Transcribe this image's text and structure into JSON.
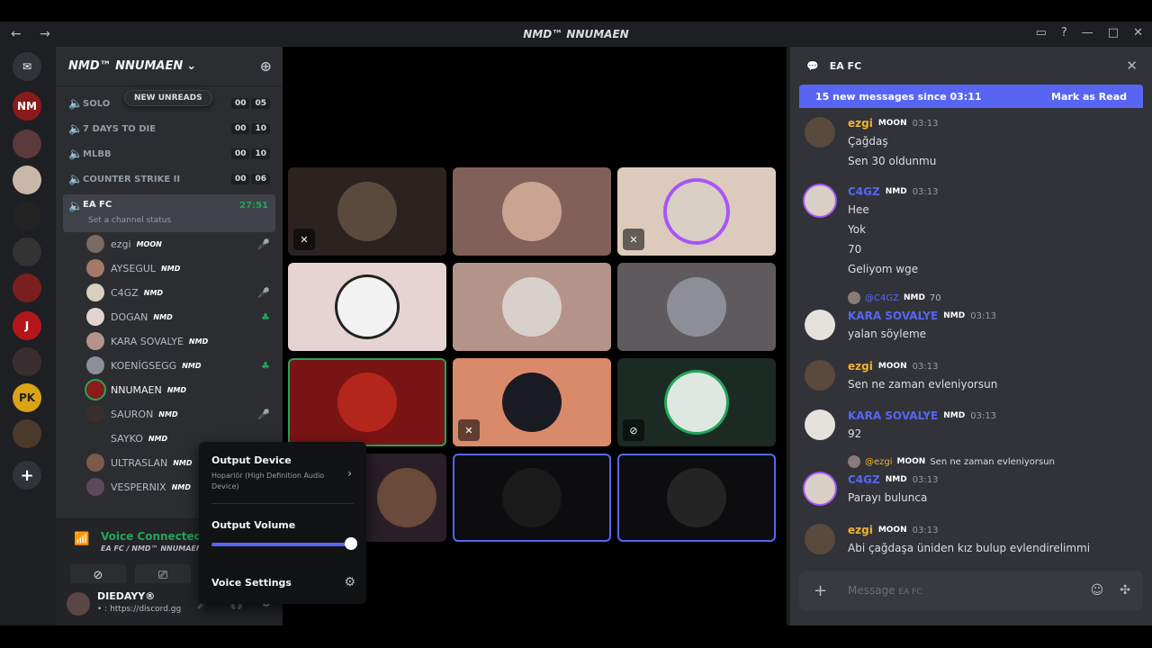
{
  "window": {
    "title": "NMD™ NNUMAEN",
    "nav": "← →",
    "controls": [
      "▭",
      "?",
      "—",
      "□",
      "✕"
    ]
  },
  "guilds": [
    "NM",
    "",
    "",
    "",
    "",
    "",
    "J",
    "",
    "PK",
    ""
  ],
  "server": {
    "name": "NMD™ NNUMAEN"
  },
  "new_unreads": "NEW UNREADS",
  "channels": [
    {
      "name": "SOLO",
      "badges": [
        "00",
        "05"
      ]
    },
    {
      "name": "7 DAYS TO DIE",
      "badges": [
        "00",
        "10"
      ]
    },
    {
      "name": "MLBB",
      "badges": [
        "00",
        "10"
      ]
    },
    {
      "name": "COUNTER STRIKE II",
      "badges": [
        "00",
        "06"
      ]
    }
  ],
  "active_channel": {
    "name": "EA FC",
    "time": "27:51",
    "status": "Set a channel status"
  },
  "members": [
    {
      "name": "ezgi",
      "tag": "MOON",
      "icon": "🎤"
    },
    {
      "name": "AYSEGUL",
      "tag": "NMD",
      "icon": ""
    },
    {
      "name": "C4GZ",
      "tag": "NMD",
      "icon": "🎤"
    },
    {
      "name": "DOGAN",
      "tag": "NMD",
      "icon": "♣"
    },
    {
      "name": "KARA SOVALYE",
      "tag": "NMD",
      "icon": ""
    },
    {
      "name": "KOENİGSEGG",
      "tag": "NMD",
      "icon": "♣"
    },
    {
      "name": "NNUMAEN",
      "tag": "NMD",
      "icon": ""
    },
    {
      "name": "SAURON",
      "tag": "NMD",
      "icon": "🎤"
    },
    {
      "name": "SAYKO",
      "tag": "NMD",
      "icon": ""
    },
    {
      "name": "ULTRASLAN",
      "tag": "NMD",
      "icon": ""
    },
    {
      "name": "VESPERNIX",
      "tag": "NMD",
      "icon": ""
    }
  ],
  "voice": {
    "status": "Voice Connected",
    "channel": "EA FC / NMD™ NNUMAEN"
  },
  "user": {
    "name": "DIEDAYY®",
    "status": "• : https://discord.gg"
  },
  "popup": {
    "output_device_label": "Output Device",
    "output_device_value": "Hoparlör (High Definition Audio Device)",
    "output_volume_label": "Output Volume",
    "output_volume": 1.0,
    "voice_settings_label": "Voice Settings"
  },
  "chat": {
    "channel": "EA FC",
    "new_messages": "15 new messages since 03:11",
    "mark_read": "Mark as Read",
    "placeholder": "Message",
    "placeholder_channel": "EA FC",
    "messages": [
      {
        "author": "ezgi",
        "tag": "MOON",
        "time": "03:13",
        "color": "#f0b232",
        "lines": [
          "Çağdaş",
          "Sen 30 oldunmu"
        ]
      },
      {
        "author": "C4GZ",
        "tag": "NMD",
        "time": "03:13",
        "color": "#5865f2",
        "lines": [
          "Hee",
          "Yok",
          "70",
          "Geliyom wge"
        ]
      },
      {
        "author": "KARA SOVALYE",
        "tag": "NMD",
        "time": "03:13",
        "color": "#5865f2",
        "reply_to": "@C4GZ",
        "reply_tag": "NMD",
        "reply_text": "70",
        "lines": [
          "yalan söyleme"
        ]
      },
      {
        "author": "ezgi",
        "tag": "MOON",
        "time": "03:13",
        "color": "#f0b232",
        "lines": [
          "Sen ne zaman evleniyorsun"
        ]
      },
      {
        "author": "KARA SOVALYE",
        "tag": "NMD",
        "time": "03:13",
        "color": "#5865f2",
        "lines": [
          "92"
        ]
      },
      {
        "author": "C4GZ",
        "tag": "NMD",
        "time": "03:13",
        "color": "#5865f2",
        "reply_to": "@ezgi",
        "reply_tag": "MOON",
        "reply_text": "Sen ne zaman evleniyorsun",
        "lines": [
          "Parayı bulunca"
        ]
      },
      {
        "author": "ezgi",
        "tag": "MOON",
        "time": "03:13",
        "color": "#f0b232",
        "lines": [
          "Abi çağdaşa üniden kız bulup evlendirelimmi"
        ]
      }
    ]
  }
}
